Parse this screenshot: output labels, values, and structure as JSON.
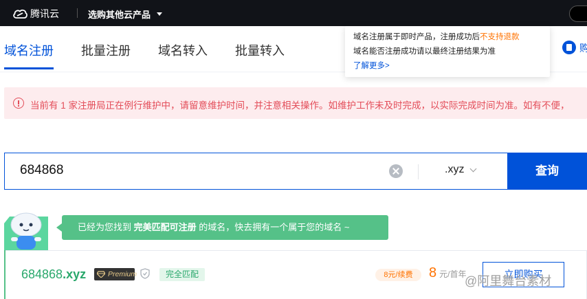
{
  "topbar": {
    "logo_text": "腾讯云",
    "product_select_label": "选购其他云产品"
  },
  "tabs": [
    {
      "label": "域名注册",
      "active": true
    },
    {
      "label": "批量注册",
      "active": false
    },
    {
      "label": "域名转入",
      "active": false
    },
    {
      "label": "批量转入",
      "active": false
    }
  ],
  "tooltip": {
    "line1_prefix": "域名注册属于即时产品，注册成功后",
    "line1_warning": "不支持退款",
    "line2": "域名能否注册成功请以最终注册结果为准",
    "link": "了解更多>"
  },
  "side_button": {
    "label": "购"
  },
  "alert": {
    "text": "当前有 1 家注册局正在例行维护中，请留意维护时间，并注意相关操作。如维护工作未及时完成，以实际完成时间为准。如有不便，"
  },
  "search": {
    "value": "684868",
    "suffix": ".xyz",
    "query_label": "查询"
  },
  "banner": {
    "prefix": "已经为您找到",
    "highlight": "完美匹配可注册",
    "suffix": "的域名，快去拥有一个属于您的域名 ~"
  },
  "result": {
    "domain_name": "684868",
    "domain_suffix": ".xyz",
    "premium_label": "Premium",
    "match_tag": "完全匹配",
    "renew_label": "8元/续费",
    "price_value": "8",
    "price_unit": "元/首年",
    "buy_label": "立即购买"
  },
  "watermark": "@阿里舞台素材",
  "colors": {
    "primary": "#0052d9",
    "topbar": "#111318",
    "alert_bg": "#fdecee",
    "alert_text": "#e34d59",
    "success": "#55c188",
    "domain_green": "#2aa86c",
    "price_orange": "#ff7200"
  },
  "icons": [
    "cloud-logo-icon",
    "caret-down-icon",
    "info-circle-icon",
    "clear-icon",
    "chevron-down-icon",
    "premium-gem-icon",
    "shield-icon",
    "cart-icon"
  ]
}
